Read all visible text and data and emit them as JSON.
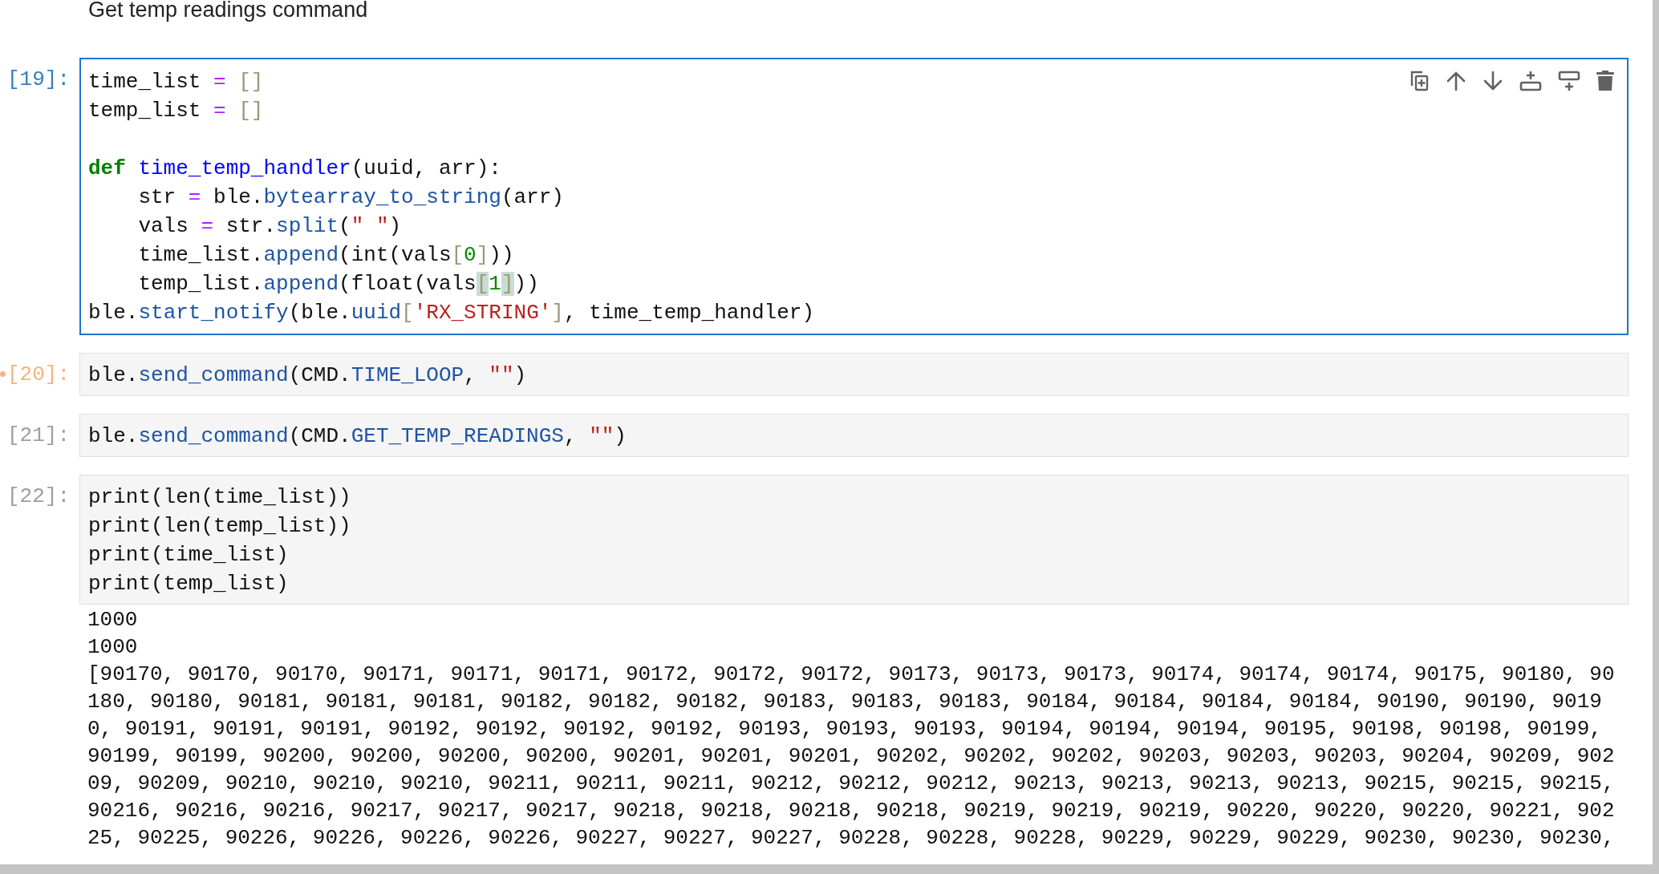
{
  "markdown": "Get temp readings command",
  "cells": [
    {
      "prompt": "[19]:",
      "kind": "active",
      "selected": true,
      "lines": [
        {
          "kind": "code",
          "tokens": [
            {
              "text": "time_list ",
              "kind": "plain"
            },
            {
              "text": "=",
              "kind": "op"
            },
            {
              "text": " []",
              "kind": "bracket"
            }
          ]
        },
        {
          "kind": "code",
          "tokens": [
            {
              "text": "temp_list ",
              "kind": "plain"
            },
            {
              "text": "=",
              "kind": "op"
            },
            {
              "text": " []",
              "kind": "bracket"
            }
          ]
        },
        {
          "kind": "blank"
        },
        {
          "kind": "code",
          "tokens": [
            {
              "text": "def",
              "kind": "keyword"
            },
            {
              "text": " time_temp_handler",
              "kind": "defname"
            },
            {
              "text": "(uuid, arr):",
              "kind": "plain"
            }
          ]
        },
        {
          "kind": "code",
          "tokens": [
            {
              "text": "    str ",
              "kind": "plain"
            },
            {
              "text": "=",
              "kind": "op"
            },
            {
              "text": " ble.",
              "kind": "plain"
            },
            {
              "text": "bytearray_to_string",
              "kind": "attr"
            },
            {
              "text": "(arr)",
              "kind": "plain"
            }
          ]
        },
        {
          "kind": "code",
          "tokens": [
            {
              "text": "    vals ",
              "kind": "plain"
            },
            {
              "text": "=",
              "kind": "op"
            },
            {
              "text": " str.",
              "kind": "plain"
            },
            {
              "text": "split",
              "kind": "attr"
            },
            {
              "text": "(",
              "kind": "plain"
            },
            {
              "text": "\" \"",
              "kind": "string"
            },
            {
              "text": ")",
              "kind": "plain"
            }
          ]
        },
        {
          "kind": "code",
          "tokens": [
            {
              "text": "    time_list.",
              "kind": "plain"
            },
            {
              "text": "append",
              "kind": "attr"
            },
            {
              "text": "(int(vals",
              "kind": "plain"
            },
            {
              "text": "[",
              "kind": "bracket"
            },
            {
              "text": "0",
              "kind": "number"
            },
            {
              "text": "]",
              "kind": "bracket"
            },
            {
              "text": "))",
              "kind": "plain"
            }
          ]
        },
        {
          "kind": "code",
          "tokens": [
            {
              "text": "    temp_list.",
              "kind": "plain"
            },
            {
              "text": "append",
              "kind": "attr"
            },
            {
              "text": "(float(vals",
              "kind": "plain"
            },
            {
              "text": "[",
              "kind": "match"
            },
            {
              "text": "1",
              "kind": "number"
            },
            {
              "text": "]",
              "kind": "match"
            },
            {
              "text": "))",
              "kind": "plain"
            }
          ]
        },
        {
          "kind": "code",
          "tokens": [
            {
              "text": "ble.",
              "kind": "plain"
            },
            {
              "text": "start_notify",
              "kind": "attr"
            },
            {
              "text": "(ble.",
              "kind": "plain"
            },
            {
              "text": "uuid",
              "kind": "attr"
            },
            {
              "text": "[",
              "kind": "bracket"
            },
            {
              "text": "'RX_STRING'",
              "kind": "string"
            },
            {
              "text": "]",
              "kind": "bracket"
            },
            {
              "text": ", time_temp_handler)",
              "kind": "plain"
            }
          ]
        }
      ]
    },
    {
      "prompt": "[20]:",
      "kind": "pending",
      "selected": false,
      "lines": [
        {
          "kind": "code",
          "tokens": [
            {
              "text": "ble.",
              "kind": "plain"
            },
            {
              "text": "send_command",
              "kind": "attr"
            },
            {
              "text": "(CMD.",
              "kind": "plain"
            },
            {
              "text": "TIME_LOOP",
              "kind": "attr"
            },
            {
              "text": ", ",
              "kind": "plain"
            },
            {
              "text": "\"\"",
              "kind": "string"
            },
            {
              "text": ")",
              "kind": "plain"
            }
          ]
        }
      ]
    },
    {
      "prompt": "[21]:",
      "kind": "idle",
      "selected": false,
      "lines": [
        {
          "kind": "code",
          "tokens": [
            {
              "text": "ble.",
              "kind": "plain"
            },
            {
              "text": "send_command",
              "kind": "attr"
            },
            {
              "text": "(CMD.",
              "kind": "plain"
            },
            {
              "text": "GET_TEMP_READINGS",
              "kind": "attr"
            },
            {
              "text": ", ",
              "kind": "plain"
            },
            {
              "text": "\"\"",
              "kind": "string"
            },
            {
              "text": ")",
              "kind": "plain"
            }
          ]
        }
      ]
    },
    {
      "prompt": "[22]:",
      "kind": "idle",
      "selected": false,
      "lines": [
        {
          "kind": "code",
          "tokens": [
            {
              "text": "print(len(time_list))",
              "kind": "plain"
            }
          ]
        },
        {
          "kind": "code",
          "tokens": [
            {
              "text": "print(len(temp_list))",
              "kind": "plain"
            }
          ]
        },
        {
          "kind": "code",
          "tokens": [
            {
              "text": "print(time_list)",
              "kind": "plain"
            }
          ]
        },
        {
          "kind": "code",
          "tokens": [
            {
              "text": "print(temp_list)",
              "kind": "plain"
            }
          ]
        }
      ],
      "output": [
        "1000",
        "1000",
        "[90170, 90170, 90170, 90171, 90171, 90171, 90172, 90172, 90172, 90173, 90173, 90173, 90174, 90174, 90174, 90175, 90180, 90",
        "180, 90180, 90181, 90181, 90181, 90182, 90182, 90182, 90183, 90183, 90183, 90184, 90184, 90184, 90184, 90190, 90190, 9019",
        "0, 90191, 90191, 90191, 90192, 90192, 90192, 90192, 90193, 90193, 90193, 90194, 90194, 90194, 90195, 90198, 90198, 90199,",
        "90199, 90199, 90200, 90200, 90200, 90200, 90201, 90201, 90201, 90202, 90202, 90202, 90203, 90203, 90203, 90204, 90209, 902",
        "09, 90209, 90210, 90210, 90210, 90211, 90211, 90211, 90212, 90212, 90212, 90213, 90213, 90213, 90213, 90215, 90215, 90215,",
        "90216, 90216, 90216, 90217, 90217, 90217, 90218, 90218, 90218, 90218, 90219, 90219, 90219, 90220, 90220, 90220, 90221, 902",
        "25, 90225, 90226, 90226, 90226, 90226, 90227, 90227, 90227, 90228, 90228, 90228, 90229, 90229, 90229, 90230, 90230, 90230,"
      ]
    }
  ]
}
